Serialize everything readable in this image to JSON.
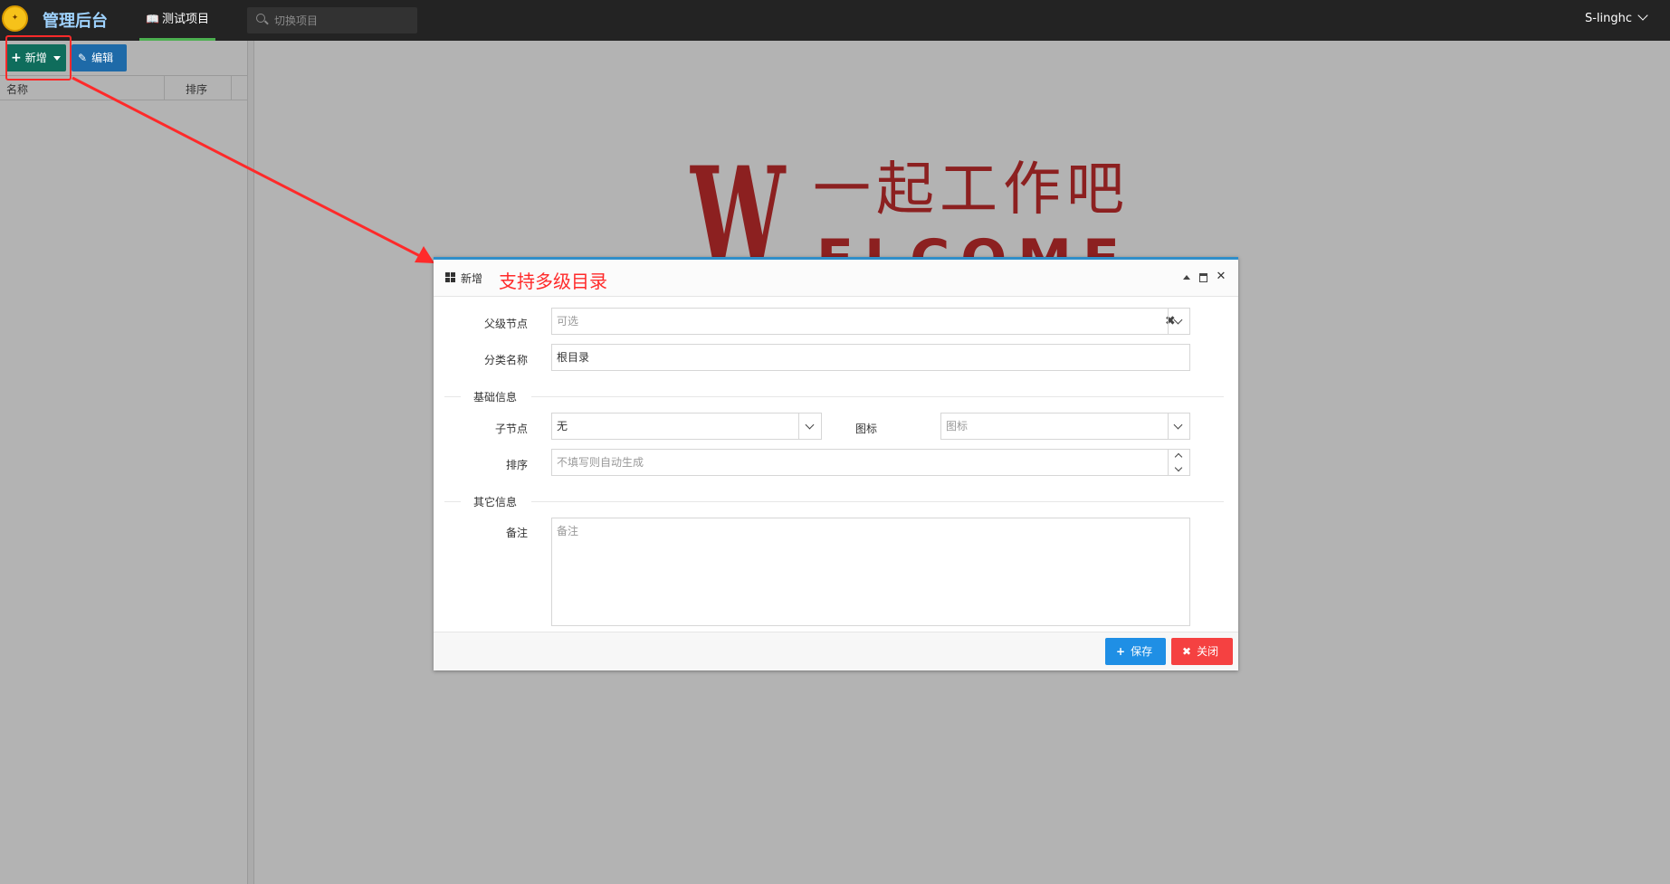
{
  "header": {
    "logo_icon": "badge-logo",
    "app_title": "管理后台",
    "nav_tab": {
      "icon": "book-icon",
      "label": "测试项目",
      "accent": "#4caf50"
    },
    "search": {
      "placeholder": "切换项目",
      "icon": "search-icon"
    },
    "user": {
      "name": "S-linghc",
      "icon": "chevron-down-icon"
    }
  },
  "left_panel": {
    "toolbar": {
      "add_label": "新增",
      "add_color": "#0f6d5c",
      "edit_label": "编辑",
      "edit_color": "#1e6aa8"
    },
    "grid": {
      "columns": [
        "名称",
        "排序"
      ]
    }
  },
  "welcome": {
    "letter": "W",
    "tagline": "一起工作吧",
    "word_rest": "ELCOME",
    "color": "#8c2020"
  },
  "annotation": {
    "color": "#ff2a2a",
    "dialog_note": "支持多级目录"
  },
  "dialog": {
    "title": "新增",
    "title_icon": "windows-icon",
    "header_buttons": [
      "collapse-icon",
      "maximize-icon",
      "close-icon"
    ],
    "fields": {
      "parent_node": {
        "label": "父级节点",
        "placeholder": "可选"
      },
      "category_name": {
        "label": "分类名称",
        "value": "根目录"
      },
      "section_basic": "基础信息",
      "child_node": {
        "label": "子节点",
        "value": "无"
      },
      "icon": {
        "label": "图标",
        "placeholder": "图标"
      },
      "sort": {
        "label": "排序",
        "placeholder": "不填写则自动生成"
      },
      "section_other": "其它信息",
      "remark": {
        "label": "备注",
        "placeholder": "备注"
      }
    },
    "footer": {
      "save_label": "保存",
      "save_color": "#1f8fe5",
      "close_label": "关闭",
      "close_color": "#f54141"
    }
  }
}
